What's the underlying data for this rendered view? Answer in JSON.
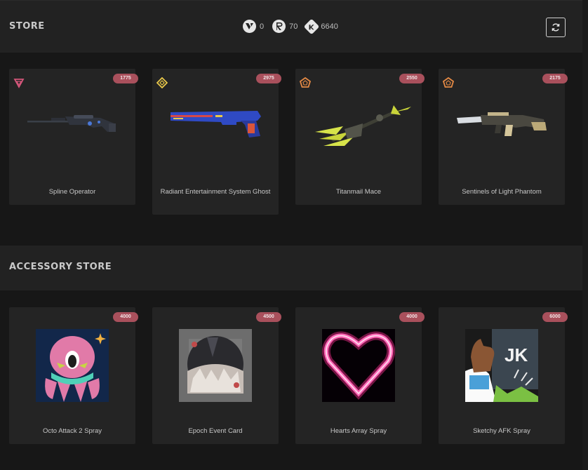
{
  "header": {
    "title": "STORE",
    "currencies": [
      {
        "icon": "valorant-points-icon",
        "value": "0"
      },
      {
        "icon": "radianite-points-icon",
        "value": "70"
      },
      {
        "icon": "kingdom-credits-icon",
        "value": "6640"
      }
    ],
    "refresh_icon": "refresh-icon"
  },
  "store": {
    "items": [
      {
        "name": "Spline Operator",
        "price": "1775",
        "tier": "exclusive",
        "tier_color": "#d4567a"
      },
      {
        "name": "Radiant Entertainment System Ghost",
        "price": "2975",
        "tier": "ultra",
        "tier_color": "#e9c84a"
      },
      {
        "name": "Titanmail Mace",
        "price": "2550",
        "tier": "premium",
        "tier_color": "#e58a45"
      },
      {
        "name": "Sentinels of Light Phantom",
        "price": "2175",
        "tier": "premium",
        "tier_color": "#e58a45"
      }
    ]
  },
  "accessory": {
    "title": "ACCESSORY STORE",
    "items": [
      {
        "name": "Octo Attack 2 Spray",
        "price": "4000"
      },
      {
        "name": "Epoch Event Card",
        "price": "4500"
      },
      {
        "name": "Hearts Array Spray",
        "price": "4000"
      },
      {
        "name": "Sketchy AFK Spray",
        "price": "6000"
      }
    ]
  },
  "colors": {
    "background": "#171717",
    "bar": "#222222",
    "card": "#242424",
    "price_badge": "#a9505c"
  }
}
